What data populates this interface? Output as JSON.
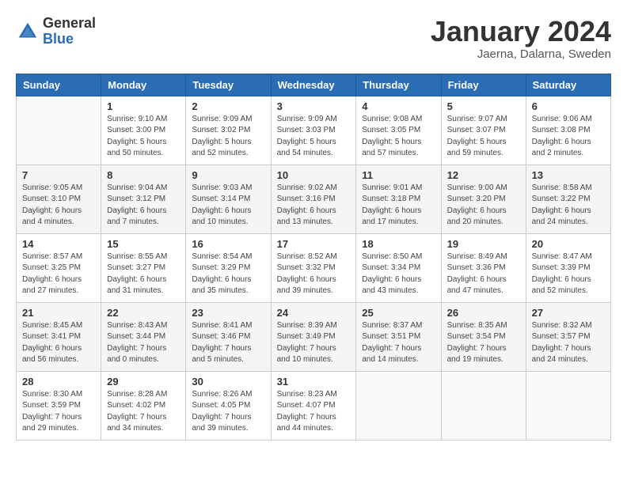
{
  "logo": {
    "general": "General",
    "blue": "Blue"
  },
  "header": {
    "month": "January 2024",
    "location": "Jaerna, Dalarna, Sweden"
  },
  "weekdays": [
    "Sunday",
    "Monday",
    "Tuesday",
    "Wednesday",
    "Thursday",
    "Friday",
    "Saturday"
  ],
  "weeks": [
    [
      {
        "day": "",
        "info": ""
      },
      {
        "day": "1",
        "info": "Sunrise: 9:10 AM\nSunset: 3:00 PM\nDaylight: 5 hours\nand 50 minutes."
      },
      {
        "day": "2",
        "info": "Sunrise: 9:09 AM\nSunset: 3:02 PM\nDaylight: 5 hours\nand 52 minutes."
      },
      {
        "day": "3",
        "info": "Sunrise: 9:09 AM\nSunset: 3:03 PM\nDaylight: 5 hours\nand 54 minutes."
      },
      {
        "day": "4",
        "info": "Sunrise: 9:08 AM\nSunset: 3:05 PM\nDaylight: 5 hours\nand 57 minutes."
      },
      {
        "day": "5",
        "info": "Sunrise: 9:07 AM\nSunset: 3:07 PM\nDaylight: 5 hours\nand 59 minutes."
      },
      {
        "day": "6",
        "info": "Sunrise: 9:06 AM\nSunset: 3:08 PM\nDaylight: 6 hours\nand 2 minutes."
      }
    ],
    [
      {
        "day": "7",
        "info": "Sunrise: 9:05 AM\nSunset: 3:10 PM\nDaylight: 6 hours\nand 4 minutes."
      },
      {
        "day": "8",
        "info": "Sunrise: 9:04 AM\nSunset: 3:12 PM\nDaylight: 6 hours\nand 7 minutes."
      },
      {
        "day": "9",
        "info": "Sunrise: 9:03 AM\nSunset: 3:14 PM\nDaylight: 6 hours\nand 10 minutes."
      },
      {
        "day": "10",
        "info": "Sunrise: 9:02 AM\nSunset: 3:16 PM\nDaylight: 6 hours\nand 13 minutes."
      },
      {
        "day": "11",
        "info": "Sunrise: 9:01 AM\nSunset: 3:18 PM\nDaylight: 6 hours\nand 17 minutes."
      },
      {
        "day": "12",
        "info": "Sunrise: 9:00 AM\nSunset: 3:20 PM\nDaylight: 6 hours\nand 20 minutes."
      },
      {
        "day": "13",
        "info": "Sunrise: 8:58 AM\nSunset: 3:22 PM\nDaylight: 6 hours\nand 24 minutes."
      }
    ],
    [
      {
        "day": "14",
        "info": "Sunrise: 8:57 AM\nSunset: 3:25 PM\nDaylight: 6 hours\nand 27 minutes."
      },
      {
        "day": "15",
        "info": "Sunrise: 8:55 AM\nSunset: 3:27 PM\nDaylight: 6 hours\nand 31 minutes."
      },
      {
        "day": "16",
        "info": "Sunrise: 8:54 AM\nSunset: 3:29 PM\nDaylight: 6 hours\nand 35 minutes."
      },
      {
        "day": "17",
        "info": "Sunrise: 8:52 AM\nSunset: 3:32 PM\nDaylight: 6 hours\nand 39 minutes."
      },
      {
        "day": "18",
        "info": "Sunrise: 8:50 AM\nSunset: 3:34 PM\nDaylight: 6 hours\nand 43 minutes."
      },
      {
        "day": "19",
        "info": "Sunrise: 8:49 AM\nSunset: 3:36 PM\nDaylight: 6 hours\nand 47 minutes."
      },
      {
        "day": "20",
        "info": "Sunrise: 8:47 AM\nSunset: 3:39 PM\nDaylight: 6 hours\nand 52 minutes."
      }
    ],
    [
      {
        "day": "21",
        "info": "Sunrise: 8:45 AM\nSunset: 3:41 PM\nDaylight: 6 hours\nand 56 minutes."
      },
      {
        "day": "22",
        "info": "Sunrise: 8:43 AM\nSunset: 3:44 PM\nDaylight: 7 hours\nand 0 minutes."
      },
      {
        "day": "23",
        "info": "Sunrise: 8:41 AM\nSunset: 3:46 PM\nDaylight: 7 hours\nand 5 minutes."
      },
      {
        "day": "24",
        "info": "Sunrise: 8:39 AM\nSunset: 3:49 PM\nDaylight: 7 hours\nand 10 minutes."
      },
      {
        "day": "25",
        "info": "Sunrise: 8:37 AM\nSunset: 3:51 PM\nDaylight: 7 hours\nand 14 minutes."
      },
      {
        "day": "26",
        "info": "Sunrise: 8:35 AM\nSunset: 3:54 PM\nDaylight: 7 hours\nand 19 minutes."
      },
      {
        "day": "27",
        "info": "Sunrise: 8:32 AM\nSunset: 3:57 PM\nDaylight: 7 hours\nand 24 minutes."
      }
    ],
    [
      {
        "day": "28",
        "info": "Sunrise: 8:30 AM\nSunset: 3:59 PM\nDaylight: 7 hours\nand 29 minutes."
      },
      {
        "day": "29",
        "info": "Sunrise: 8:28 AM\nSunset: 4:02 PM\nDaylight: 7 hours\nand 34 minutes."
      },
      {
        "day": "30",
        "info": "Sunrise: 8:26 AM\nSunset: 4:05 PM\nDaylight: 7 hours\nand 39 minutes."
      },
      {
        "day": "31",
        "info": "Sunrise: 8:23 AM\nSunset: 4:07 PM\nDaylight: 7 hours\nand 44 minutes."
      },
      {
        "day": "",
        "info": ""
      },
      {
        "day": "",
        "info": ""
      },
      {
        "day": "",
        "info": ""
      }
    ]
  ]
}
